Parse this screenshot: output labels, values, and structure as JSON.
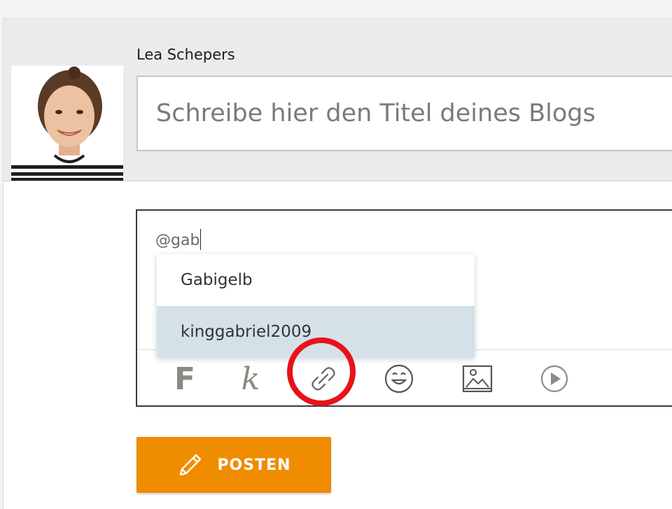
{
  "author": {
    "name": "Lea Schepers"
  },
  "title_field": {
    "placeholder": "Schreibe hier den Titel deines Blogs",
    "value": ""
  },
  "editor": {
    "text": "@gab"
  },
  "mention_suggestions": [
    {
      "label": "Gabigelb",
      "selected": false
    },
    {
      "label": "kinggabriel2009",
      "selected": true
    }
  ],
  "toolbar": {
    "bold_label": "F",
    "italic_label": "k",
    "icons": [
      "link-icon",
      "emoji-icon",
      "image-icon",
      "video-play-icon"
    ]
  },
  "post_button": {
    "label": "POSTEN",
    "icon": "pencil-icon"
  },
  "colors": {
    "accent": "#f08c00",
    "highlight_ring": "#e8121a",
    "suggestion_selected": "#d5e1e8"
  }
}
